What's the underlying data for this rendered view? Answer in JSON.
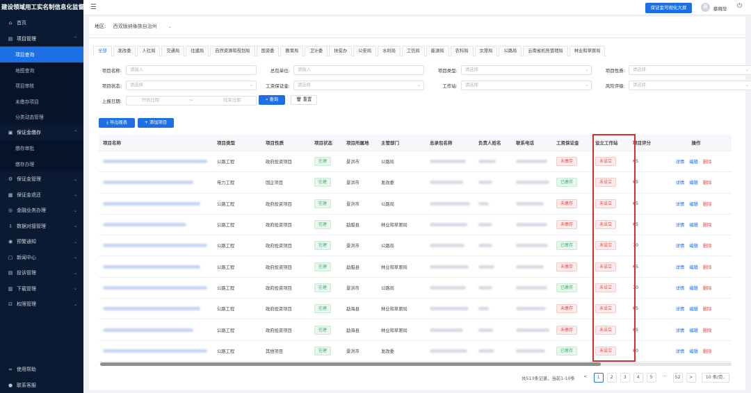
{
  "app": {
    "title": "建设领域用工实名制信息化监督平台"
  },
  "header": {
    "bigscreen_label": "保证金可视化大屏",
    "username": "蔡晓华",
    "avatar_initial": "蔡"
  },
  "sidebar": {
    "items": [
      {
        "type": "item",
        "icon": "⌂",
        "label": "首页"
      },
      {
        "type": "group",
        "icon": "▤",
        "label": "项目管理",
        "chevron": "⌃"
      },
      {
        "type": "sub",
        "label": "项目查询",
        "active": true
      },
      {
        "type": "sub",
        "label": "地图查询"
      },
      {
        "type": "sub",
        "label": "项目审核"
      },
      {
        "type": "sub",
        "label": "未缴存项目"
      },
      {
        "type": "sub",
        "label": "分类动态管理"
      },
      {
        "type": "group",
        "icon": "▣",
        "label": "保证金缴存",
        "chevron": "⌃"
      },
      {
        "type": "sub",
        "label": "缴存审批"
      },
      {
        "type": "sub",
        "label": "缴存办理"
      },
      {
        "type": "item",
        "icon": "⚙",
        "label": "保证金管理",
        "chevron": "⌄"
      },
      {
        "type": "item",
        "icon": "▦",
        "label": "保证金退还",
        "chevron": "⌄"
      },
      {
        "type": "item",
        "icon": "◎",
        "label": "金融业务办理",
        "chevron": "⌄"
      },
      {
        "type": "item",
        "icon": "⇩",
        "label": "数据对接管理",
        "chevron": "⌄"
      },
      {
        "type": "item",
        "icon": "◉",
        "label": "预警通知",
        "chevron": "⌄"
      },
      {
        "type": "item",
        "icon": "▢",
        "label": "新闻中心",
        "chevron": "⌄"
      },
      {
        "type": "item",
        "icon": "▤",
        "label": "投诉管理",
        "chevron": "⌄"
      },
      {
        "type": "item",
        "icon": "▥",
        "label": "下载管理",
        "chevron": "⌄"
      },
      {
        "type": "item",
        "icon": "⊡",
        "label": "权限管理",
        "chevron": "⌄"
      }
    ],
    "help_label": "使用帮助",
    "service_label": "联系客服"
  },
  "region": {
    "label": "地区:",
    "value": "西双版纳傣族自治州"
  },
  "tabs": [
    "全部",
    "发改委",
    "人社局",
    "交通局",
    "住建局",
    "自然资源和规划局",
    "国资委",
    "教育局",
    "卫计委",
    "扶贫办",
    "公安局",
    "水利局",
    "工信局",
    "能源局",
    "农科局",
    "文旅局",
    "公路局",
    "云南省机务管理局",
    "林业和草原局"
  ],
  "filters": {
    "project_name": {
      "label": "项目名称:",
      "placeholder": "请输入"
    },
    "contractor": {
      "label": "总包单位:",
      "placeholder": "请输入"
    },
    "project_type": {
      "label": "项目类型:",
      "placeholder": "请选择"
    },
    "project_nature": {
      "label": "项目性质:",
      "placeholder": "请选择"
    },
    "project_status": {
      "label": "项目状态:",
      "placeholder": "请选择"
    },
    "wage_bond": {
      "label": "工资保证金:",
      "placeholder": "请选择"
    },
    "workstation": {
      "label": "工作站:",
      "placeholder": "请选择"
    },
    "risk_rating": {
      "label": "风险评级:",
      "placeholder": "请选择"
    },
    "report_date": {
      "label": "上报日期:",
      "start_placeholder": "开始日期",
      "separator": "~",
      "end_placeholder": "结束日期"
    },
    "search_label": "查询",
    "reset_label": "重置"
  },
  "actions": {
    "export_label": "导出报表",
    "add_label": "+ 添加项目"
  },
  "table": {
    "headers": [
      "项目名称",
      "项目类型",
      "项目性质",
      "项目状态",
      "项目所属地",
      "主管部门",
      "总承包名称",
      "负责人姓名",
      "联系电话",
      "工资保证金",
      "设立工作站",
      "项目评分",
      "操作"
    ],
    "rows": [
      {
        "type": "公路工程",
        "nature": "政府投资项目",
        "status": "在建",
        "location": "景洪市",
        "dept": "公路局",
        "bond": "未缴存",
        "bond_color": "red",
        "station": "未设立",
        "score": "65"
      },
      {
        "type": "电力工程",
        "nature": "国企项目",
        "status": "在建",
        "location": "景洪市",
        "dept": "发改委",
        "bond": "已缴存",
        "bond_color": "green",
        "station": "未设立",
        "score": "65"
      },
      {
        "type": "公路工程",
        "nature": "政府投资项目",
        "status": "在建",
        "location": "景洪市",
        "dept": "公路局",
        "bond": "未缴存",
        "bond_color": "red",
        "station": "未设立",
        "score": "65"
      },
      {
        "type": "公路工程",
        "nature": "政府投资项目",
        "status": "在建",
        "location": "勐腊县",
        "dept": "林业和草原局",
        "bond": "未缴存",
        "bond_color": "red",
        "station": "未设立",
        "score": "65"
      },
      {
        "type": "公路工程",
        "nature": "政府投资项目",
        "status": "在建",
        "location": "景洪市",
        "dept": "公路局",
        "bond": "已缴存",
        "bond_color": "green",
        "station": "未设立",
        "score": "70"
      },
      {
        "type": "公路工程",
        "nature": "政府投资项目",
        "status": "在建",
        "location": "勐腊县",
        "dept": "林业和草原局",
        "bond": "未缴存",
        "bond_color": "red",
        "station": "未设立",
        "score": "65"
      },
      {
        "type": "公路工程",
        "nature": "政府投资项目",
        "status": "在建",
        "location": "景洪市",
        "dept": "公路局",
        "bond": "已缴存",
        "bond_color": "green",
        "station": "未设立",
        "score": "70"
      },
      {
        "type": "公路工程",
        "nature": "政府投资项目",
        "status": "在建",
        "location": "勐海县",
        "dept": "林业和草原局",
        "bond": "未缴存",
        "bond_color": "red",
        "station": "未设立",
        "score": "65"
      },
      {
        "type": "公路工程",
        "nature": "政府投资项目",
        "status": "在建",
        "location": "勐海县",
        "dept": "林业和草原局",
        "bond": "未缴存",
        "bond_color": "red",
        "station": "未设立",
        "score": "65"
      },
      {
        "type": "公路工程",
        "nature": "其他项目",
        "status": "在建",
        "location": "景洪市",
        "dept": "发改委",
        "bond": "已缴存",
        "bond_color": "green",
        "station": "未设立",
        "score": "80"
      }
    ],
    "row_actions": {
      "detail": "详情",
      "edit": "编辑",
      "delete": "删除"
    }
  },
  "pagination": {
    "summary": "共513条记录，当前1-10条",
    "prev": "<",
    "pages": [
      "1",
      "2",
      "3",
      "4",
      "5",
      "···",
      "52"
    ],
    "active": "1",
    "next": ">",
    "page_size": "10 条/页"
  },
  "colors": {
    "accent": "#1d6fe6",
    "sidebar_bg": "#0b1a33",
    "highlight": "#e02a2a",
    "danger": "#e0483f",
    "success": "#3bb36b"
  }
}
